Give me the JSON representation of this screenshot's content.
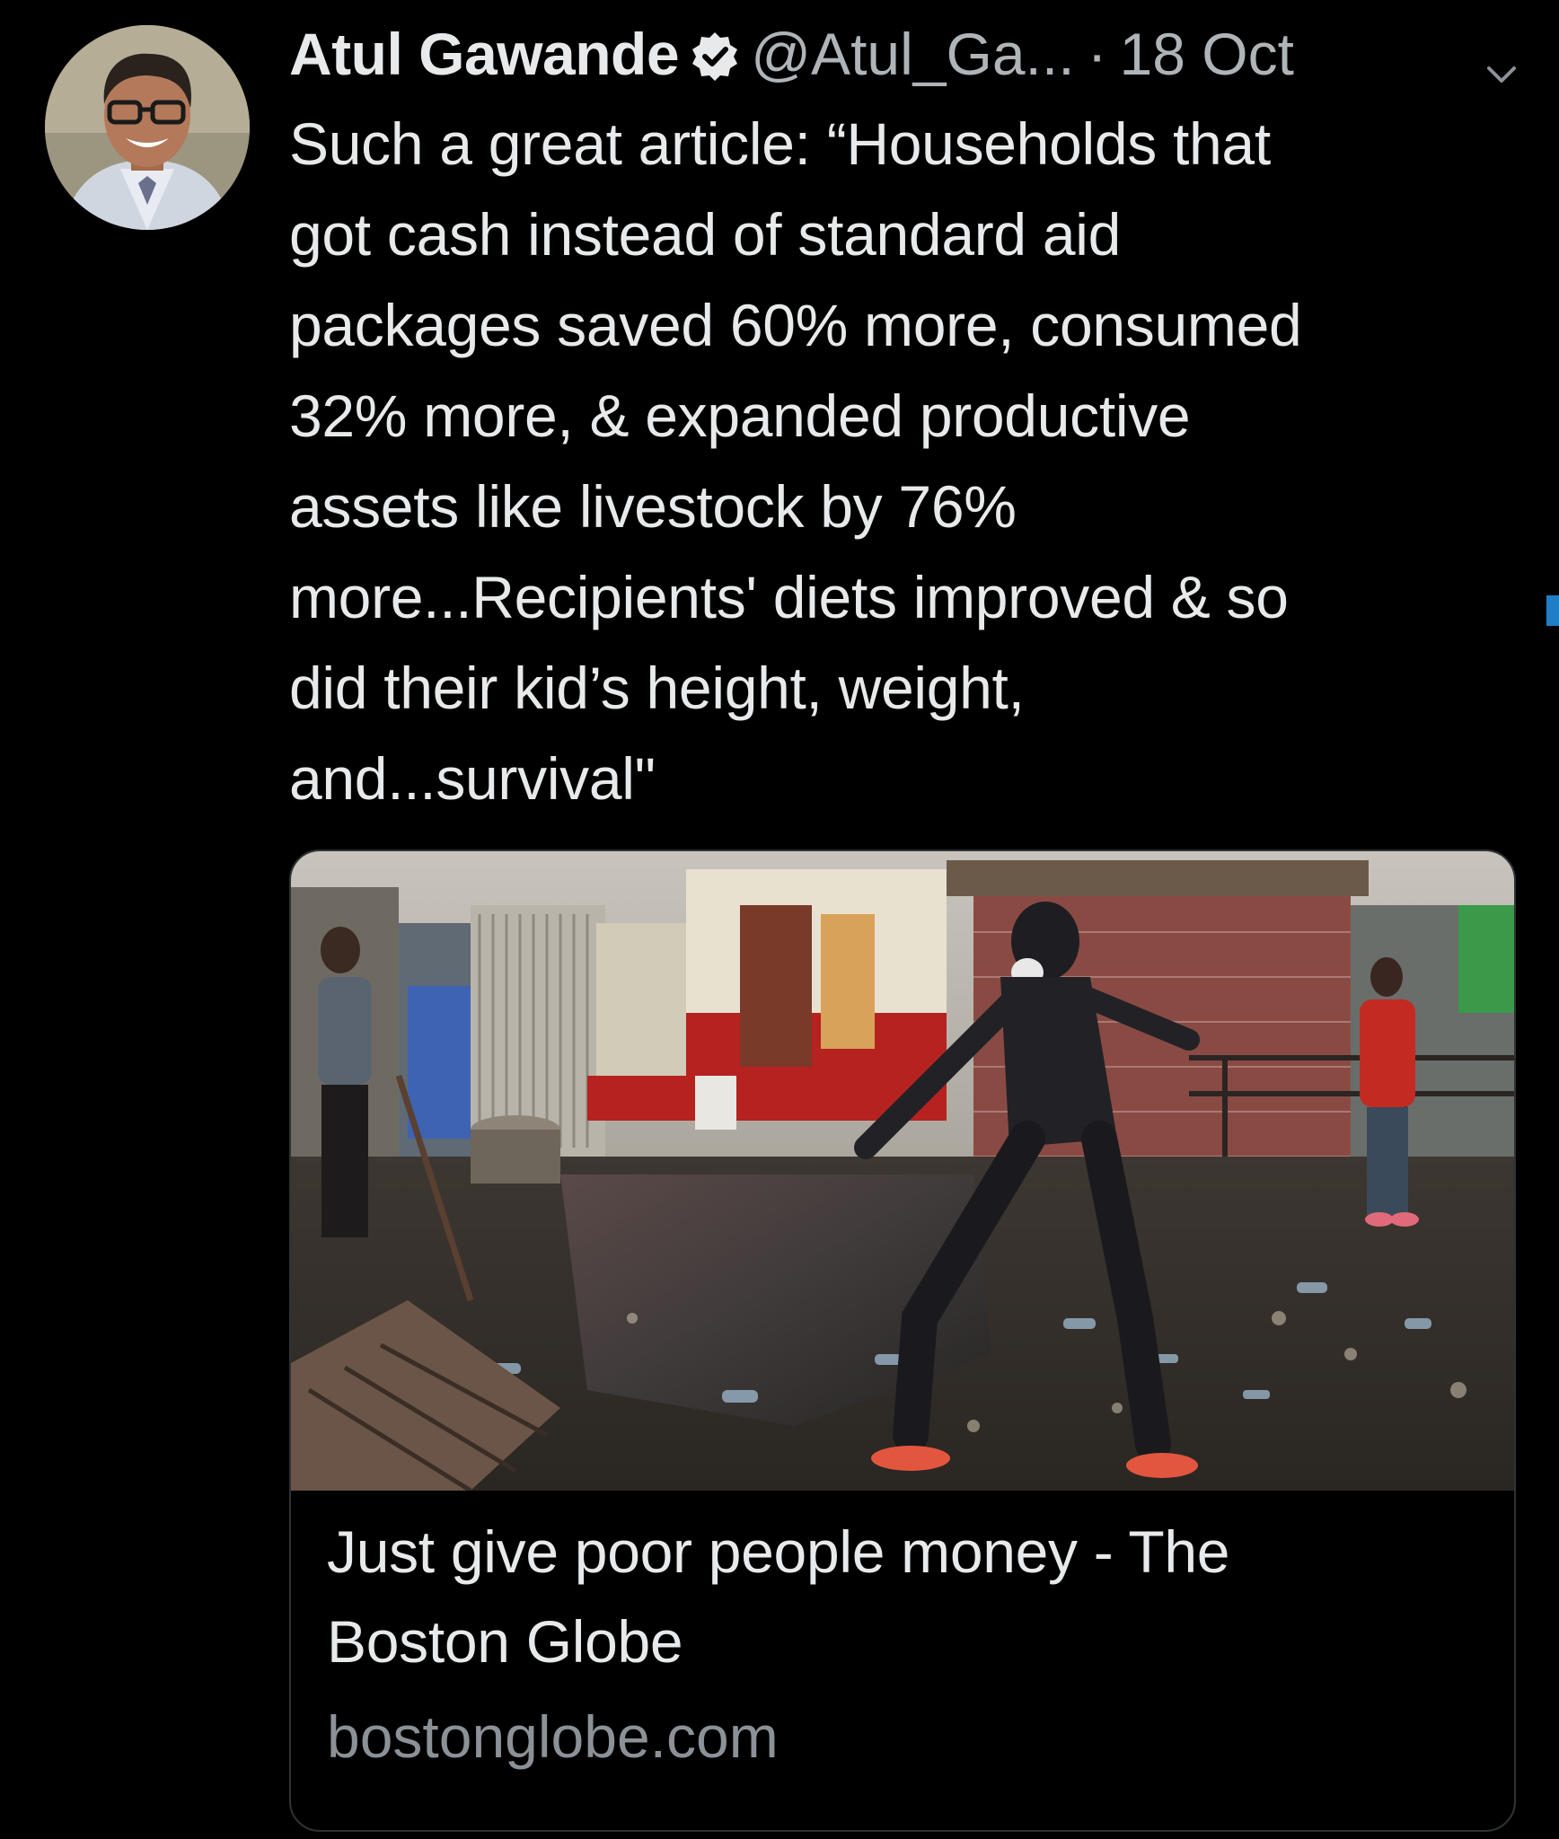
{
  "tweet": {
    "author": {
      "name": "Atul Gawande",
      "verified_icon": "verified-badge-icon",
      "handle": "@Atul_Ga...",
      "separator": "·",
      "date": "18 Oct"
    },
    "menu_icon": "chevron-down-icon",
    "text": "Such a great article: “Households that\ngot cash instead of standard aid\npackages saved 60% more, consumed\n32% more, & expanded productive\nassets like livestock by 76%\nmore...Recipients' diets improved & so\ndid their kid’s height, weight,\nand...survival\"",
    "card": {
      "title": "Just give poor people money - The\nBoston Globe",
      "domain": "bostonglobe.com"
    }
  },
  "colors": {
    "background": "#000000",
    "primary_text": "#e7e9ea",
    "secondary_text": "#aeb4b8",
    "card_border": "#2f3336",
    "accent": "#1f7ec6"
  }
}
